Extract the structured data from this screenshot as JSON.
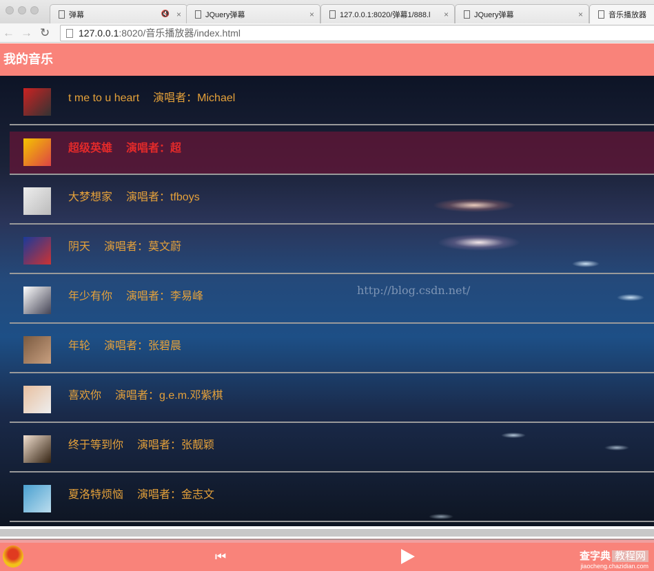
{
  "browser": {
    "tabs": [
      {
        "title": "弹幕",
        "muted": true
      },
      {
        "title": "JQuery弹幕"
      },
      {
        "title": "127.0.0.1:8020/弹幕1/888.l"
      },
      {
        "title": "JQuery弹幕"
      },
      {
        "title": "音乐播放器",
        "active": true
      }
    ],
    "url_host": "127.0.0.1",
    "url_rest": ":8020/音乐播放器/index.html"
  },
  "header": {
    "title": "我的音乐"
  },
  "songs": [
    {
      "title": "t me to u heart",
      "singer": "演唱者：Michael",
      "cover": [
        "#c22",
        "#333"
      ]
    },
    {
      "title": "超级英雄",
      "singer": "演唱者：超",
      "cover": [
        "#f5c400",
        "#d44"
      ],
      "selected": true
    },
    {
      "title": "大梦想家",
      "singer": "演唱者：tfboys",
      "cover": [
        "#eee",
        "#bbb"
      ]
    },
    {
      "title": "阴天",
      "singer": "演唱者：莫文蔚",
      "cover": [
        "#1a3a9a",
        "#c33"
      ]
    },
    {
      "title": "年少有你",
      "singer": "演唱者：李易峰",
      "cover": [
        "#fff",
        "#445"
      ]
    },
    {
      "title": "年轮",
      "singer": "演唱者：张碧晨",
      "cover": [
        "#7a5a40",
        "#c9a080"
      ]
    },
    {
      "title": "喜欢你",
      "singer": "演唱者：g.e.m.邓紫棋",
      "cover": [
        "#e8c0a0",
        "#eee"
      ]
    },
    {
      "title": "终于等到你",
      "singer": "演唱者：张靓颖",
      "cover": [
        "#f2e0d0",
        "#321"
      ]
    },
    {
      "title": "夏洛特烦恼",
      "singer": "演唱者：金志文",
      "cover": [
        "#4aa0d0",
        "#bde"
      ]
    }
  ],
  "watermark": "http://blog.csdn.net/",
  "footer": {
    "logo_main": "查字典",
    "logo_box": "教程网",
    "logo_sub": "jiaocheng.chazidian.com"
  },
  "colors": {
    "accent": "#f9837a",
    "song_text": "#e5a13a",
    "selected_text": "#e22a2a"
  }
}
